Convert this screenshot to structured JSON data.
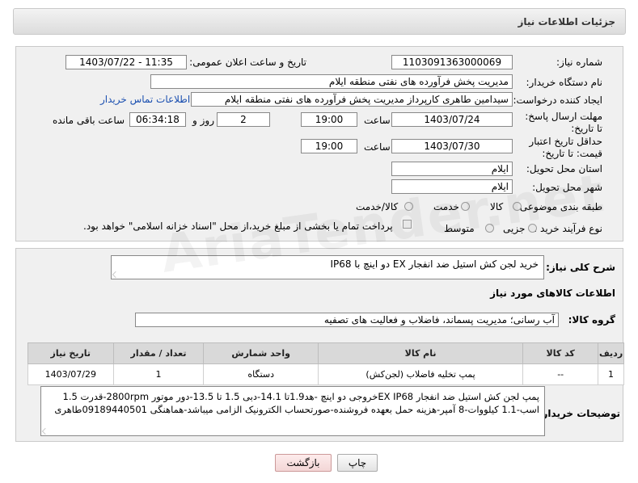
{
  "header": {
    "title": "جزئیات اطلاعات نیاز"
  },
  "form": {
    "need_number_label": "شماره نیاز:",
    "need_number": "1103091363000069",
    "announce_label": "تاریخ و ساعت اعلان عمومی:",
    "announce_value": "1403/07/22 - 11:35",
    "buyer_org_label": "نام دستگاه خریدار:",
    "buyer_org": "مدیریت پخش فرآورده های نفتی منطقه ایلام",
    "creator_label": "ایجاد کننده درخواست:",
    "creator": "سیدامین طاهری کارپرداز مدیریت پخش فرآورده های نفتی منطقه ایلام",
    "contact_link": "اطلاعات تماس خریدار",
    "reply_deadline_label": "مهلت ارسال پاسخ: تا تاریخ:",
    "reply_date": "1403/07/24",
    "time_label": "ساعت",
    "reply_time": "19:00",
    "days_value": "2",
    "days_label": "روز و",
    "remaining_value": "06:34:18",
    "remaining_label": "ساعت باقی مانده",
    "validity_label": "حداقل تاریخ اعتبار قیمت: تا تاریخ:",
    "validity_date": "1403/07/30",
    "validity_time_label": "ساعت",
    "validity_time": "19:00",
    "province_label": "استان محل تحویل:",
    "province": "ایلام",
    "city_label": "شهر محل تحویل:",
    "city": "ایلام",
    "category_label": "طبقه بندی موضوعی:",
    "category_options": [
      "کالا",
      "خدمت",
      "کالا/خدمت"
    ],
    "purchase_type_label": "نوع فرآیند خرید :",
    "purchase_options": [
      "جزیی",
      "متوسط"
    ],
    "payment_note": "پرداخت تمام یا بخشی از مبلغ خرید،از محل \"اسناد خزانه اسلامی\" خواهد بود."
  },
  "description": {
    "label": "شرح کلی نیاز:",
    "value": "خرید لجن کش استیل ضد انفجار EX دو اینچ با IP68"
  },
  "goods": {
    "section_title": "اطلاعات کالاهای مورد نیاز",
    "group_label": "گروه کالا:",
    "group_value": "آب رسانی؛ مدیریت پسماند، فاضلاب و فعالیت های تصفیه",
    "table": {
      "headers": [
        "ردیف",
        "کد کالا",
        "نام کالا",
        "واحد شمارش",
        "تعداد / مقدار",
        "تاریخ نیاز"
      ],
      "rows": [
        [
          "1",
          "--",
          "پمپ تخلیه فاضلاب (لجن‌کش)",
          "دستگاه",
          "1",
          "1403/07/29"
        ]
      ]
    }
  },
  "buyer_notes": {
    "label": "توضیحات خریدار:",
    "line1": "پمپ لجن کش استیل ضد انفجار EX IP68خروجی دو اینچ -هد1.9تا 14.1-دبی 1.5 تا 13.5-دور موتور 2800rpm-قدرت 1.5",
    "line2": "اسب-1.1 کیلووات-8 آمپر-هزینه حمل بعهده فروشنده-صورتحساب الکترونیک الزامی میباشد-هماهنگی 09189440501طاهری"
  },
  "buttons": {
    "print": "چاپ",
    "back": "بازگشت"
  },
  "watermark": "AriaTender.net"
}
